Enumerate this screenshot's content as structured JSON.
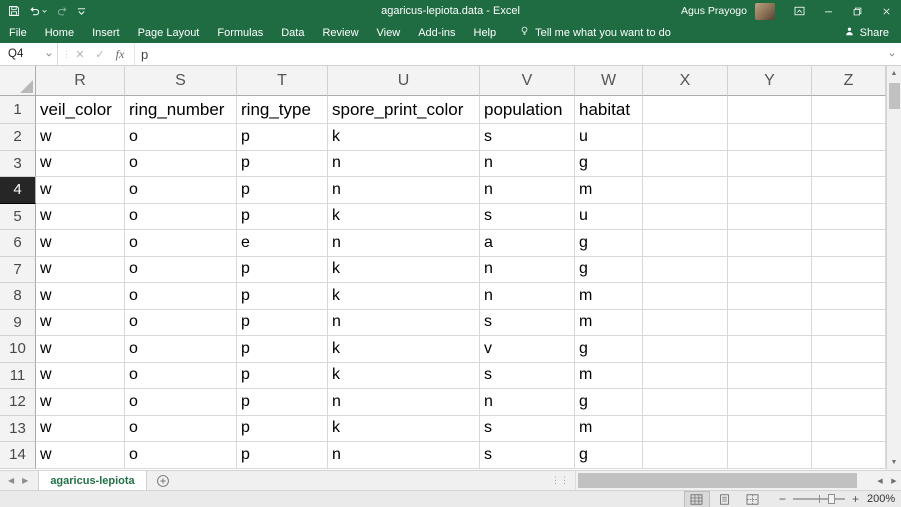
{
  "colors": {
    "excel_green": "#1f6c43",
    "active_sheet_text": "#217346",
    "selected_row_header": "#262626",
    "gridline": "#d9d9d9"
  },
  "title_bar": {
    "title": "agaricus-lepiota.data - Excel",
    "user": "Agus Prayogo"
  },
  "ribbon": {
    "tabs": [
      "File",
      "Home",
      "Insert",
      "Page Layout",
      "Formulas",
      "Data",
      "Review",
      "View",
      "Add-ins",
      "Help"
    ],
    "tell_me": "Tell me what you want to do",
    "share_label": "Share"
  },
  "formula_bar": {
    "name_box": "Q4",
    "fx_label": "fx",
    "formula": "p"
  },
  "sheet": {
    "columns": [
      "R",
      "S",
      "T",
      "U",
      "V",
      "W",
      "X",
      "Y",
      "Z"
    ],
    "row_numbers": [
      1,
      2,
      3,
      4,
      5,
      6,
      7,
      8,
      9,
      10,
      11,
      12,
      13,
      14
    ],
    "header_row": [
      "veil_color",
      "ring_number",
      "ring_type",
      "spore_print_color",
      "population",
      "habitat"
    ],
    "data": [
      [
        "w",
        "o",
        "p",
        "k",
        "s",
        "u"
      ],
      [
        "w",
        "o",
        "p",
        "n",
        "n",
        "g"
      ],
      [
        "w",
        "o",
        "p",
        "n",
        "n",
        "m"
      ],
      [
        "w",
        "o",
        "p",
        "k",
        "s",
        "u"
      ],
      [
        "w",
        "o",
        "e",
        "n",
        "a",
        "g"
      ],
      [
        "w",
        "o",
        "p",
        "k",
        "n",
        "g"
      ],
      [
        "w",
        "o",
        "p",
        "k",
        "n",
        "m"
      ],
      [
        "w",
        "o",
        "p",
        "n",
        "s",
        "m"
      ],
      [
        "w",
        "o",
        "p",
        "k",
        "v",
        "g"
      ],
      [
        "w",
        "o",
        "p",
        "k",
        "s",
        "m"
      ],
      [
        "w",
        "o",
        "p",
        "n",
        "n",
        "g"
      ],
      [
        "w",
        "o",
        "p",
        "k",
        "s",
        "m"
      ],
      [
        "w",
        "o",
        "p",
        "n",
        "s",
        "g"
      ]
    ],
    "selected_cell": "Q4",
    "selected_row": 4
  },
  "tab_bar": {
    "active_sheet": "agaricus-lepiota"
  },
  "status_bar": {
    "zoom": "200%"
  }
}
